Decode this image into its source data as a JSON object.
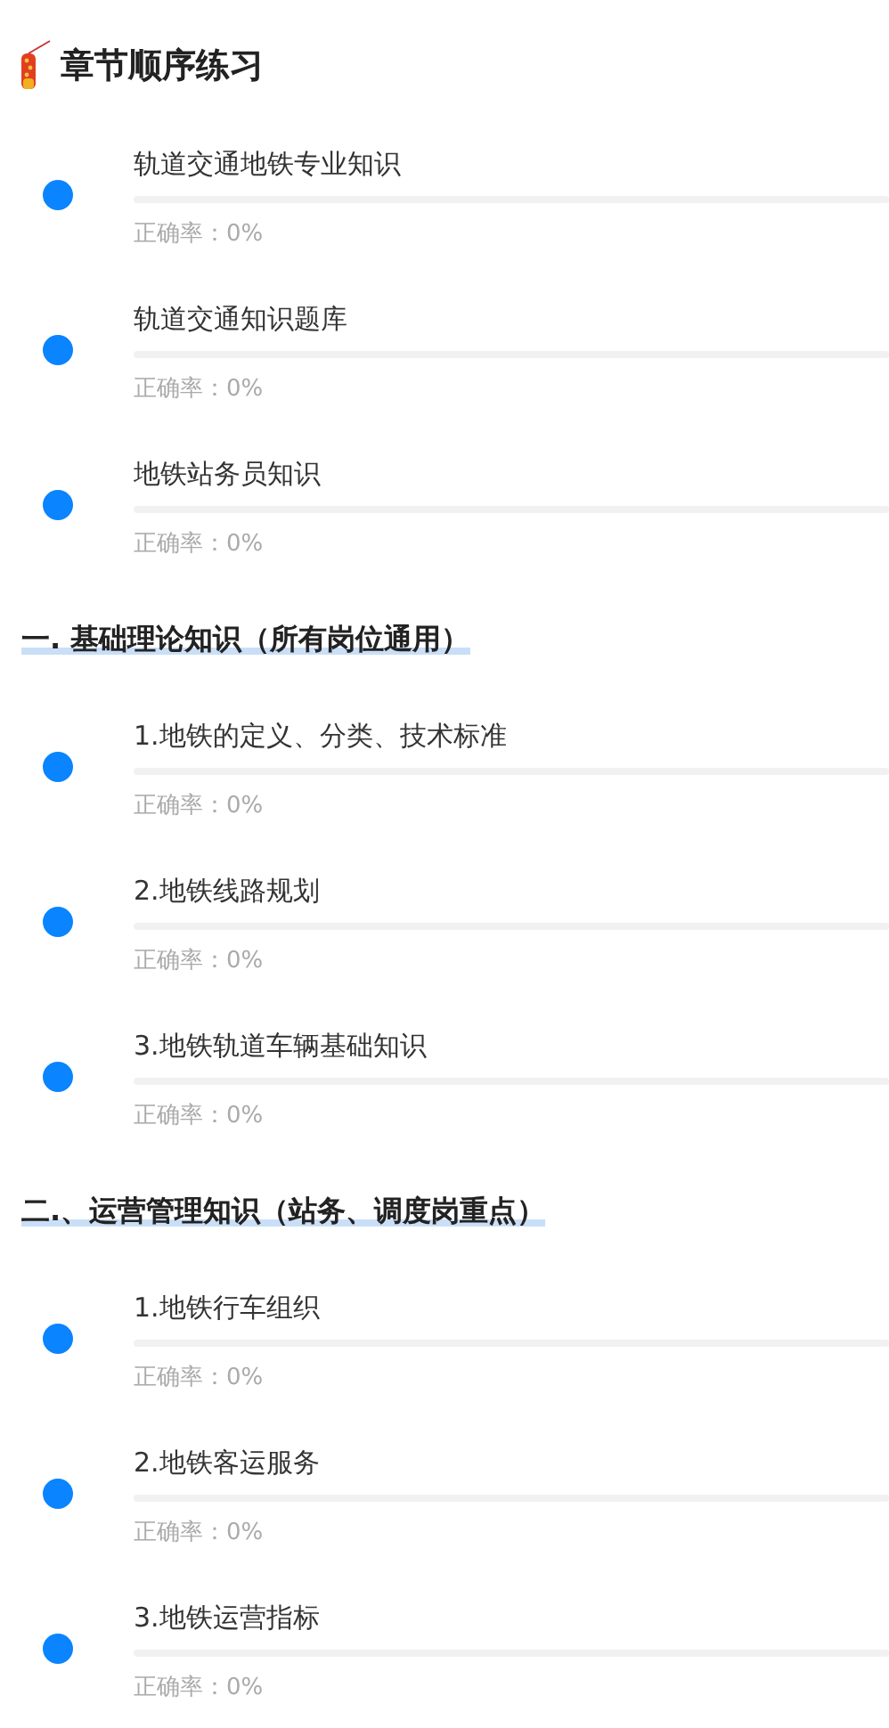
{
  "header": {
    "title": "章节顺序练习"
  },
  "sections": [
    {
      "items": [
        {
          "title": "轨道交通地铁专业知识",
          "accuracy": "正确率：0%",
          "level": 0
        },
        {
          "title": "轨道交通知识题库",
          "accuracy": "正确率：0%",
          "level": 0
        },
        {
          "title": "地铁站务员知识",
          "accuracy": "正确率：0%",
          "level": 0
        }
      ]
    },
    {
      "heading": "一. 基础理论知识（所有岗位通用）",
      "items": [
        {
          "title": "1.地铁的定义、分类、技术标准",
          "accuracy": "正确率：0%",
          "level": 0
        },
        {
          "title": "2.地铁线路规划",
          "accuracy": "正确率：0%",
          "level": 0
        },
        {
          "title": "3.地铁轨道车辆基础知识",
          "accuracy": "正确率：0%",
          "level": 0
        }
      ]
    },
    {
      "heading": "二.、运营管理知识（站务、调度岗重点）",
      "items": [
        {
          "title": "1.地铁行车组织",
          "accuracy": "正确率：0%",
          "level": 0
        },
        {
          "title": "2.地铁客运服务",
          "accuracy": "正确率：0%",
          "level": 0
        },
        {
          "title": "3.地铁运营指标",
          "accuracy": "正确率：0%",
          "level": 0
        }
      ]
    }
  ]
}
